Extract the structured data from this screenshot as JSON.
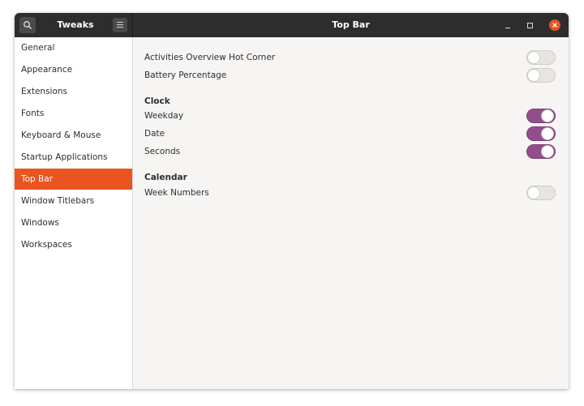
{
  "header": {
    "app_title": "Tweaks",
    "page_title": "Top Bar"
  },
  "sidebar": {
    "items": [
      {
        "label": "General",
        "selected": false
      },
      {
        "label": "Appearance",
        "selected": false
      },
      {
        "label": "Extensions",
        "selected": false
      },
      {
        "label": "Fonts",
        "selected": false
      },
      {
        "label": "Keyboard & Mouse",
        "selected": false
      },
      {
        "label": "Startup Applications",
        "selected": false
      },
      {
        "label": "Top Bar",
        "selected": true
      },
      {
        "label": "Window Titlebars",
        "selected": false
      },
      {
        "label": "Windows",
        "selected": false
      },
      {
        "label": "Workspaces",
        "selected": false
      }
    ]
  },
  "main": {
    "hot_corner": {
      "label": "Activities Overview Hot Corner",
      "on": false
    },
    "battery": {
      "label": "Battery Percentage",
      "on": false
    },
    "clock": {
      "heading": "Clock",
      "weekday": {
        "label": "Weekday",
        "on": true
      },
      "date": {
        "label": "Date",
        "on": true
      },
      "seconds": {
        "label": "Seconds",
        "on": true
      }
    },
    "calendar": {
      "heading": "Calendar",
      "week_numbers": {
        "label": "Week Numbers",
        "on": false
      }
    }
  },
  "colors": {
    "accent": "#e95420",
    "switch_on": "#924d8b",
    "headerbar": "#2d2d2d"
  },
  "icons": {
    "search": "search-icon",
    "menu": "hamburger-menu-icon",
    "minimize": "minimize-icon",
    "maximize": "maximize-icon",
    "close": "close-icon"
  }
}
